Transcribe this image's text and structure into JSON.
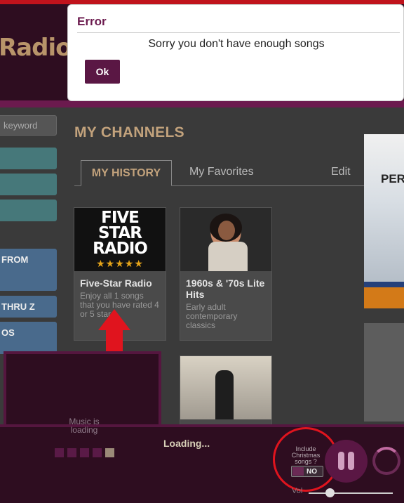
{
  "header": {
    "logo_text": "Radio"
  },
  "sidebar": {
    "search_placeholder": "keyword",
    "buttons": [
      "FROM",
      "THRU Z",
      "OS"
    ]
  },
  "main": {
    "heading": "MY CHANNELS",
    "tabs": [
      {
        "label": "MY HISTORY",
        "active": true
      },
      {
        "label": "My Favorites",
        "active": false
      }
    ],
    "edit_label": "Edit",
    "cards": [
      {
        "art_lines": [
          "FIVE",
          "STAR",
          "RADIO"
        ],
        "art_stars": "★★★★★",
        "title": "Five-Star Radio",
        "description": "Enjoy all 1 songs that you have rated 4 or 5 stars"
      },
      {
        "title": "1960s & '70s Lite Hits",
        "description": "Early adult contemporary classics"
      },
      {
        "title": "",
        "description": ""
      }
    ],
    "right_banner_text": "PER"
  },
  "player": {
    "music_status": "Music is loading",
    "loading_text": "Loading...",
    "christmas_label": "Include Christmas songs ?",
    "christmas_toggle": "NO",
    "volume_label": "Vol",
    "volume_level": 0.25
  },
  "dialog": {
    "title": "Error",
    "message": "Sorry you don't have enough songs",
    "ok_label": "Ok"
  },
  "colors": {
    "brand": "#5a1744",
    "accent_gold": "#c2a27c",
    "annotation_red": "#e0141e"
  }
}
